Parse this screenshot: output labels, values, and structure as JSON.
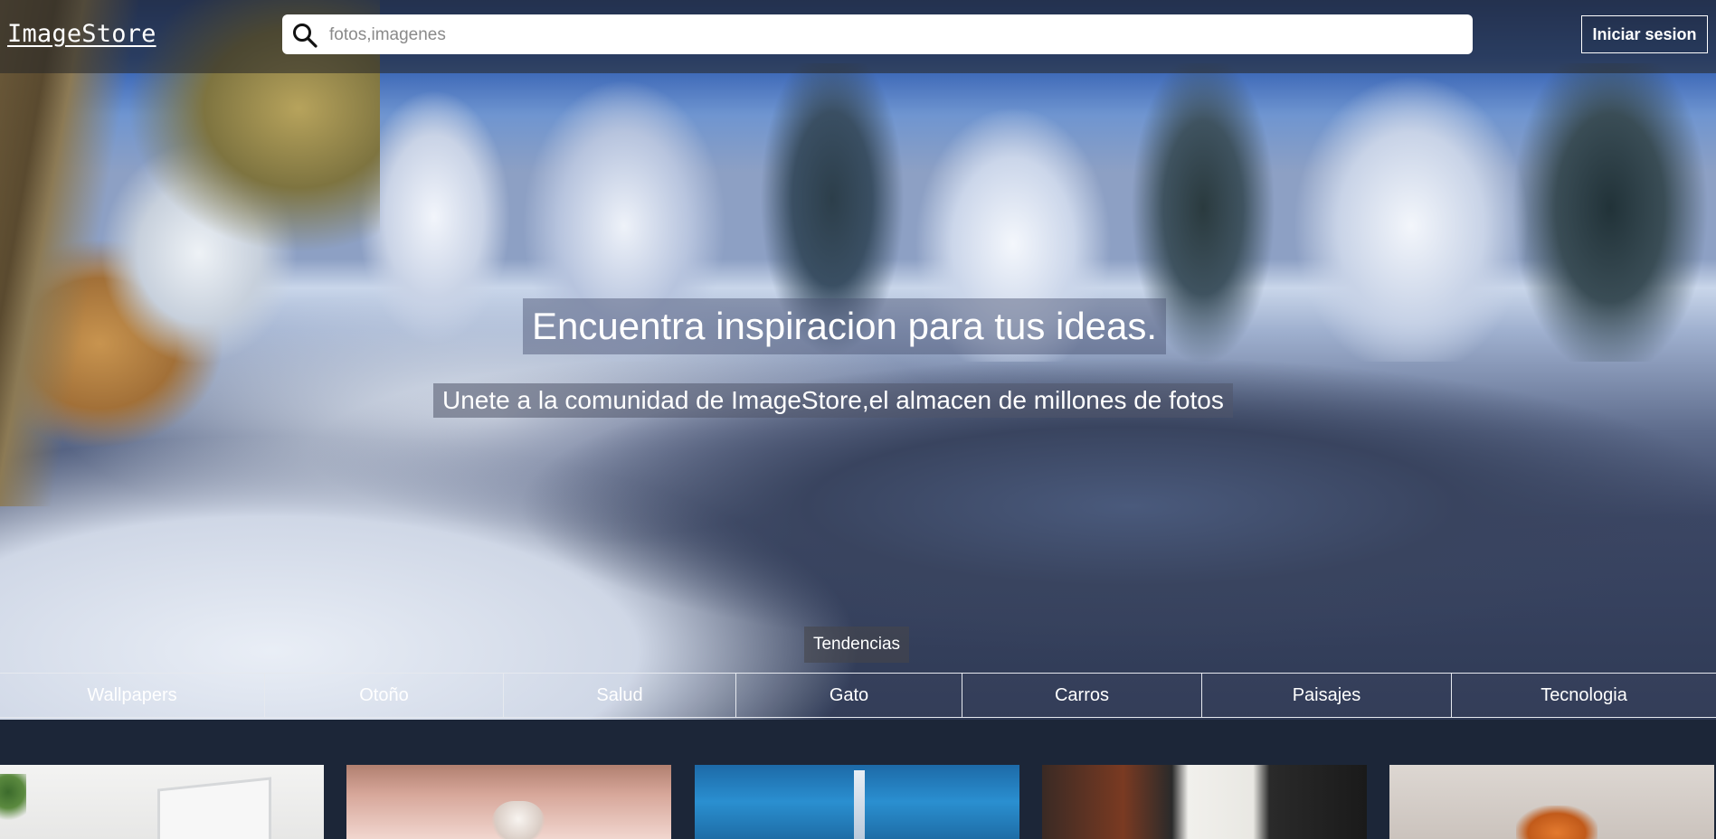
{
  "header": {
    "logo": "ImageStore",
    "search_placeholder": "fotos,imagenes",
    "search_icon": "search-icon",
    "login_label": "Iniciar sesion"
  },
  "hero": {
    "headline": "Encuentra inspiracion para tus ideas.",
    "subline": "Unete a la comunidad de ImageStore,el almacen de millones de fotos"
  },
  "trends": {
    "label": "Tendencias",
    "categories": [
      "Wallpapers",
      "Otoño",
      "Salud",
      "Gato",
      "Carros",
      "Paisajes",
      "Tecnologia"
    ]
  },
  "colors": {
    "page_background": "#1c2638",
    "header_overlay": "rgba(40,40,40,0.58)",
    "text": "#ffffff"
  }
}
